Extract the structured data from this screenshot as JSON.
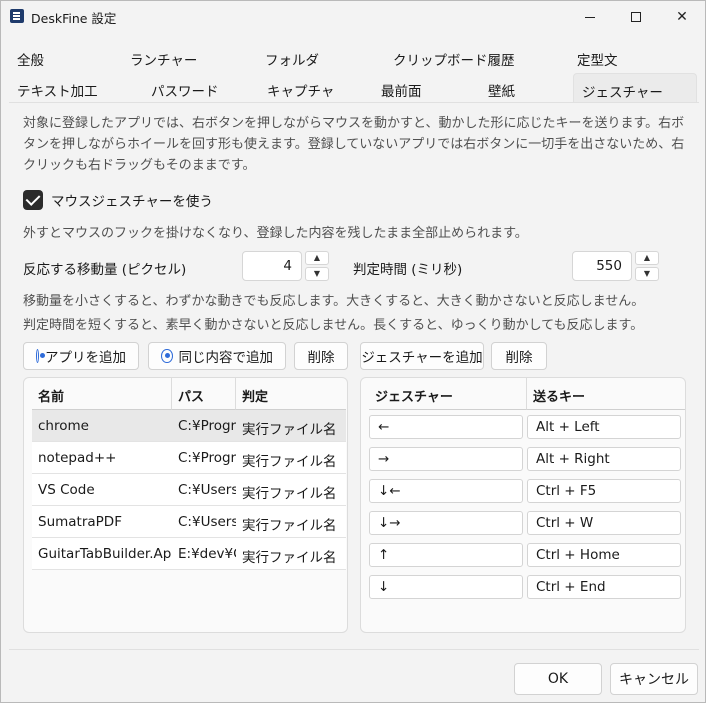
{
  "window": {
    "title": "DeskFine 設定"
  },
  "tabs": {
    "row1": [
      "全般",
      "ランチャー",
      "フォルダ",
      "クリップボード履歴",
      "定型文"
    ],
    "row2": [
      "テキスト加工",
      "パスワード",
      "キャプチャ",
      "最前面",
      "壁紙",
      "ジェスチャー"
    ]
  },
  "gesture": {
    "description": "対象に登録したアプリでは、右ボタンを押しながらマウスを動かすと、動かした形に応じたキーを送ります。右ボタンを押しながらホイールを回す形も使えます。登録していないアプリでは右ボタンに一切手を出さないため、右クリックも右ドラッグもそのままです。",
    "enable_label": "マウスジェスチャーを使う",
    "enable_note": "外すとマウスのフックを掛けなくなり、登録した内容を残したまま全部止められます。",
    "move_label": "反応する移動量 (ピクセル)",
    "move_value": "4",
    "time_label": "判定時間 (ミリ秒)",
    "time_value": "550",
    "hint1": "移動量を小さくすると、わずかな動きでも反応します。大きくすると、大きく動かさないと反応しません。",
    "hint2": "判定時間を短くすると、素早く動かさないと反応しません。長くすると、ゆっくり動かしても反応します。",
    "buttons": {
      "add_app": "アプリを追加",
      "add_same": "同じ内容で追加",
      "delete_app": "削除",
      "add_gesture": "ジェスチャーを追加",
      "delete_gesture": "削除"
    },
    "apps_table": {
      "headers": [
        "名前",
        "パス",
        "判定"
      ],
      "rows": [
        [
          "chrome",
          "C:¥Progra",
          "実行ファイル名"
        ],
        [
          "notepad++",
          "C:¥Progra",
          "実行ファイル名"
        ],
        [
          "VS Code",
          "C:¥Users¥",
          "実行ファイル名"
        ],
        [
          "SumatraPDF",
          "C:¥Users¥",
          "実行ファイル名"
        ],
        [
          "GuitarTabBuilder.App",
          "E:¥dev¥G",
          "実行ファイル名"
        ]
      ]
    },
    "gesture_table": {
      "headers": [
        "ジェスチャー",
        "送るキー"
      ],
      "rows": [
        [
          "←",
          "Alt + Left"
        ],
        [
          "→",
          "Alt + Right"
        ],
        [
          "↓←",
          "Ctrl + F5"
        ],
        [
          "↓→",
          "Ctrl + W"
        ],
        [
          "↑",
          "Ctrl + Home"
        ],
        [
          "↓",
          "Ctrl + End"
        ]
      ]
    }
  },
  "footer": {
    "ok": "OK",
    "cancel": "キャンセル"
  }
}
